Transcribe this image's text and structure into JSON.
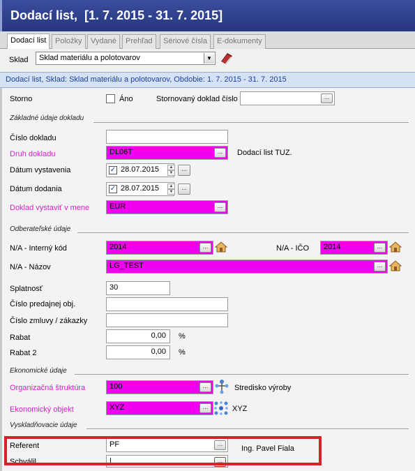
{
  "title": "Dodací list,  [1. 7. 2015 - 31. 7. 2015]",
  "tabs": [
    "Dodací list",
    "Položky",
    "Vydané",
    "Prehľad",
    "Sériové čísla",
    "E-dokumenty"
  ],
  "warehouse": {
    "label": "Sklad",
    "value": "Sklad materiálu a polotovarov",
    "arrow": "▼"
  },
  "status_text": "Dodací list, Sklad: Sklad materiálu a polotovarov, Obdobie: 1. 7. 2015 - 31. 7. 2015",
  "storno": {
    "label": "Storno",
    "checkbox_label": "Áno",
    "ref_label": "Stornovaný doklad číslo"
  },
  "sections": {
    "basic": "Základné údaje dokladu",
    "customer": "Odberateľské údaje",
    "economic": "Ekonomické údaje",
    "billing": "Vyskladňovacie údaje"
  },
  "basic": {
    "doc_number_label": "Číslo dokladu",
    "doc_type_label": "Druh dokladu",
    "doc_type_value": "DL06T",
    "doc_type_desc": "Dodací list TUZ.",
    "issue_date_label": "Dátum vystavenia",
    "issue_date_value": "28.07.2015",
    "delivery_date_label": "Dátum dodania",
    "delivery_date_value": "28.07.2015",
    "currency_label": "Doklad vystaviť v mene",
    "currency_value": "EUR"
  },
  "customer": {
    "internal_code_label": "N/A - Interný kód",
    "internal_code_value": "2014",
    "ico_label": "N/A - IČO",
    "ico_value": "2014",
    "name_label": "N/A - Názov",
    "name_value": "LG_TEST",
    "due_label": "Splatnosť",
    "due_value": "30",
    "order_label": "Číslo predajnej obj.",
    "contract_label": "Číslo zmluvy / zákazky",
    "discount_label": "Rabat",
    "discount_value": "0,00",
    "discount2_label": "Rabat 2",
    "discount2_value": "0,00",
    "percent": "%"
  },
  "economic": {
    "org_label": "Organizačná štruktúra",
    "org_value": "100",
    "org_desc": "Stredisko výroby",
    "obj_label": "Ekonomický objekt",
    "obj_value": "XYZ",
    "obj_desc": "XYZ"
  },
  "billing": {
    "referent_label": "Referent",
    "referent_value": "PF",
    "referent_desc": "Ing. Pavel Fiala",
    "approved_label": "Schválil",
    "approved_value": "|"
  },
  "colors": {
    "title_bg": "#2f3f8a",
    "required": "#f000ee",
    "required_label": "#d21ec8",
    "highlight": "#d8202a"
  },
  "icons": [
    "book-icon",
    "house-icon",
    "org-tree-icon",
    "objects-icon",
    "calendar-icon"
  ]
}
